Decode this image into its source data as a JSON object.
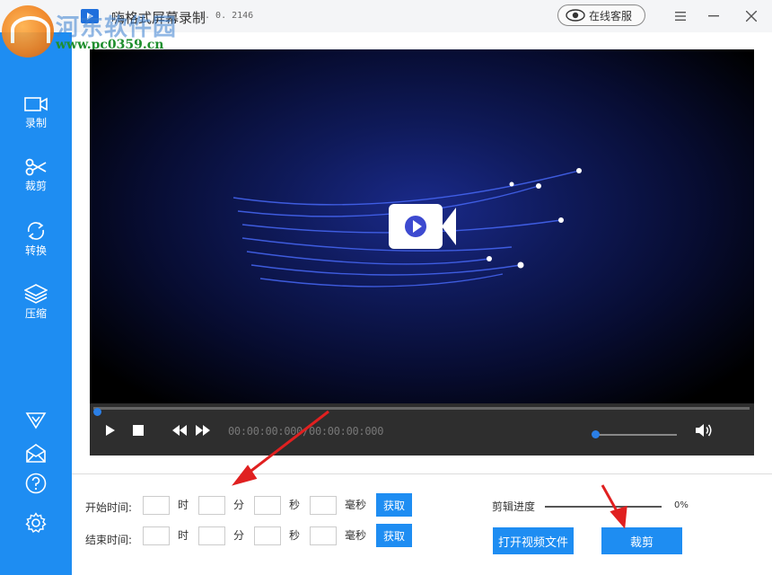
{
  "titlebar": {
    "app_title": "嗨格式屏幕录制",
    "version": "1. 0. 2146",
    "service_button": "在线客服"
  },
  "watermark": {
    "site_name": "河东软件园",
    "url": "www.pc0359.cn"
  },
  "sidebar": {
    "items": [
      {
        "label": "录制",
        "icon": "record-icon"
      },
      {
        "label": "裁剪",
        "icon": "scissors-icon"
      },
      {
        "label": "转换",
        "icon": "convert-icon"
      },
      {
        "label": "压缩",
        "icon": "compress-icon"
      }
    ],
    "bottom_icons": [
      "vip-icon",
      "message-icon",
      "help-icon",
      "settings-icon"
    ]
  },
  "player": {
    "timecode": "00:00:00:000/00:00:00:000",
    "seek_progress": 0,
    "volume_level": 1.0
  },
  "trim": {
    "start_label": "开始时间:",
    "end_label": "结束时间:",
    "units": {
      "hour": "时",
      "minute": "分",
      "second": "秒",
      "millisecond": "毫秒"
    },
    "get_button": "获取",
    "start_values": {
      "hour": "",
      "minute": "",
      "second": "",
      "millisecond": ""
    },
    "end_values": {
      "hour": "",
      "minute": "",
      "second": "",
      "millisecond": ""
    }
  },
  "progress": {
    "label": "剪辑进度",
    "percent_text": "0%",
    "value": 0
  },
  "actions": {
    "open_video": "打开视频文件",
    "cut": "裁剪"
  },
  "colors": {
    "accent": "#1e8df2",
    "annotation_arrow": "#e02020"
  }
}
